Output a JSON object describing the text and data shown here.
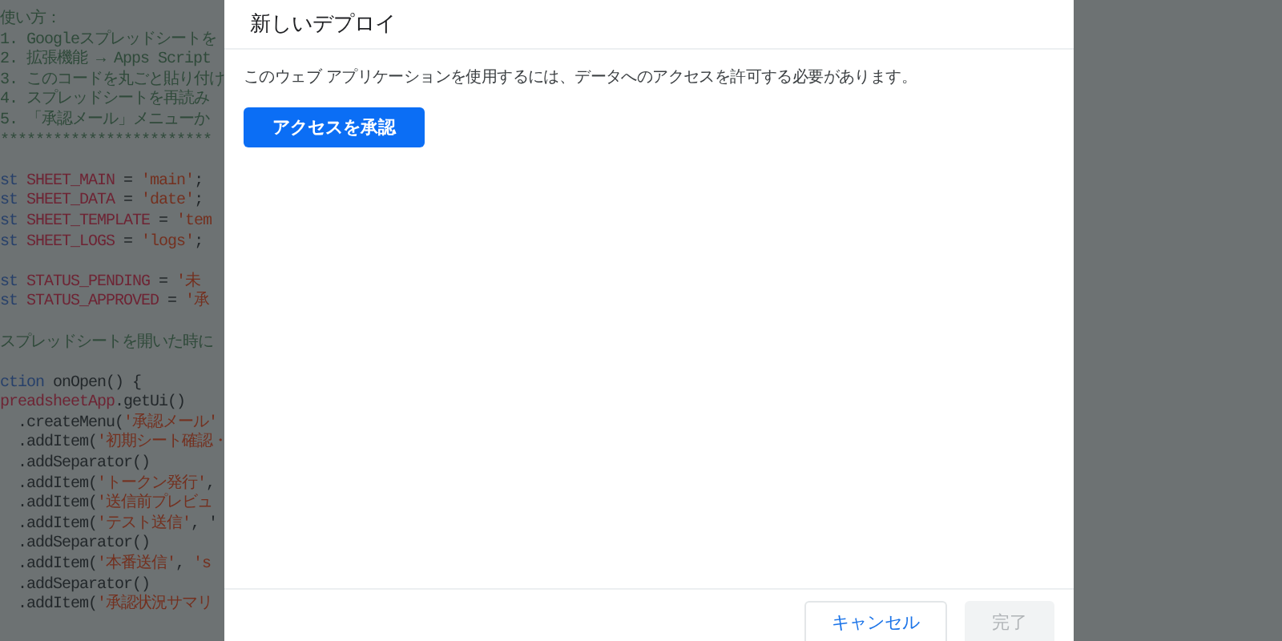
{
  "editor": {
    "lines": [
      {
        "kind": "text",
        "segments": [
          {
            "kind": "comment",
            "text": "使い方："
          }
        ]
      },
      {
        "kind": "text",
        "segments": [
          {
            "kind": "comment",
            "text": "1. Googleスプレッドシートを"
          }
        ]
      },
      {
        "kind": "text",
        "segments": [
          {
            "kind": "comment",
            "text": "2. 拡張機能 → Apps Script"
          }
        ]
      },
      {
        "kind": "text",
        "segments": [
          {
            "kind": "comment",
            "text": "3. このコードを丸ごと貼り付け"
          }
        ]
      },
      {
        "kind": "text",
        "segments": [
          {
            "kind": "comment",
            "text": "4. スプレッドシートを再読み"
          }
        ]
      },
      {
        "kind": "text",
        "segments": [
          {
            "kind": "comment",
            "text": "5. 「承認メール」メニューか"
          }
        ]
      },
      {
        "kind": "text",
        "segments": [
          {
            "kind": "comment",
            "text": "************************"
          }
        ]
      },
      {
        "kind": "blank"
      },
      {
        "kind": "text",
        "segments": [
          {
            "kind": "keyword",
            "text": "st "
          },
          {
            "kind": "constant",
            "text": "SHEET_MAIN"
          },
          {
            "kind": "plain",
            "text": " = "
          },
          {
            "kind": "string",
            "text": "'main'"
          },
          {
            "kind": "plain",
            "text": ";"
          }
        ]
      },
      {
        "kind": "text",
        "segments": [
          {
            "kind": "keyword",
            "text": "st "
          },
          {
            "kind": "constant",
            "text": "SHEET_DATA"
          },
          {
            "kind": "plain",
            "text": " = "
          },
          {
            "kind": "string",
            "text": "'date'"
          },
          {
            "kind": "plain",
            "text": ";"
          }
        ]
      },
      {
        "kind": "text",
        "segments": [
          {
            "kind": "keyword",
            "text": "st "
          },
          {
            "kind": "constant",
            "text": "SHEET_TEMPLATE"
          },
          {
            "kind": "plain",
            "text": " = "
          },
          {
            "kind": "string",
            "text": "'tem"
          }
        ]
      },
      {
        "kind": "text",
        "segments": [
          {
            "kind": "keyword",
            "text": "st "
          },
          {
            "kind": "constant",
            "text": "SHEET_LOGS"
          },
          {
            "kind": "plain",
            "text": " = "
          },
          {
            "kind": "string",
            "text": "'logs'"
          },
          {
            "kind": "plain",
            "text": ";"
          }
        ]
      },
      {
        "kind": "blank"
      },
      {
        "kind": "text",
        "segments": [
          {
            "kind": "keyword",
            "text": "st "
          },
          {
            "kind": "constant",
            "text": "STATUS_PENDING"
          },
          {
            "kind": "plain",
            "text": " = "
          },
          {
            "kind": "string",
            "text": "'未"
          }
        ]
      },
      {
        "kind": "text",
        "segments": [
          {
            "kind": "keyword",
            "text": "st "
          },
          {
            "kind": "constant",
            "text": "STATUS_APPROVED"
          },
          {
            "kind": "plain",
            "text": " = "
          },
          {
            "kind": "string",
            "text": "'承"
          }
        ]
      },
      {
        "kind": "blank"
      },
      {
        "kind": "text",
        "segments": [
          {
            "kind": "comment",
            "text": "スプレッドシートを開いた時に"
          }
        ]
      },
      {
        "kind": "blank"
      },
      {
        "kind": "text",
        "segments": [
          {
            "kind": "keyword",
            "text": "ction "
          },
          {
            "kind": "plain",
            "text": "onOpen() {"
          }
        ]
      },
      {
        "kind": "text",
        "segments": [
          {
            "kind": "constant",
            "text": "preadsheetApp"
          },
          {
            "kind": "plain",
            "text": ".getUi()"
          }
        ]
      },
      {
        "kind": "text",
        "segments": [
          {
            "kind": "plain",
            "text": "  .createMenu("
          },
          {
            "kind": "string",
            "text": "'承認メール'"
          }
        ]
      },
      {
        "kind": "text",
        "segments": [
          {
            "kind": "plain",
            "text": "  .addItem("
          },
          {
            "kind": "string",
            "text": "'初期シート確認・"
          }
        ]
      },
      {
        "kind": "text",
        "segments": [
          {
            "kind": "plain",
            "text": "  .addSeparator()"
          }
        ]
      },
      {
        "kind": "text",
        "segments": [
          {
            "kind": "plain",
            "text": "  .addItem("
          },
          {
            "kind": "string",
            "text": "'トークン発行'"
          },
          {
            "kind": "plain",
            "text": ","
          }
        ]
      },
      {
        "kind": "text",
        "segments": [
          {
            "kind": "plain",
            "text": "  .addItem("
          },
          {
            "kind": "string",
            "text": "'送信前プレビュ"
          }
        ]
      },
      {
        "kind": "text",
        "segments": [
          {
            "kind": "plain",
            "text": "  .addItem("
          },
          {
            "kind": "string",
            "text": "'テスト送信'"
          },
          {
            "kind": "plain",
            "text": ", '"
          }
        ]
      },
      {
        "kind": "text",
        "segments": [
          {
            "kind": "plain",
            "text": "  .addSeparator()"
          }
        ]
      },
      {
        "kind": "text",
        "segments": [
          {
            "kind": "plain",
            "text": "  .addItem("
          },
          {
            "kind": "string",
            "text": "'本番送信'"
          },
          {
            "kind": "plain",
            "text": ", "
          },
          {
            "kind": "string",
            "text": "'s"
          }
        ]
      },
      {
        "kind": "text",
        "segments": [
          {
            "kind": "plain",
            "text": "  .addSeparator()"
          }
        ]
      },
      {
        "kind": "text",
        "segments": [
          {
            "kind": "plain",
            "text": "  .addItem("
          },
          {
            "kind": "string",
            "text": "'承認状況サマリ"
          }
        ]
      }
    ]
  },
  "dialog": {
    "title": "新しいデプロイ",
    "message": "このウェブ アプリケーションを使用するには、データへのアクセスを許可する必要があります。",
    "authorize_button": "アクセスを承認",
    "footer_buttons": [
      {
        "label": "キャンセル",
        "disabled": false
      },
      {
        "label": "完了",
        "disabled": true
      }
    ]
  }
}
